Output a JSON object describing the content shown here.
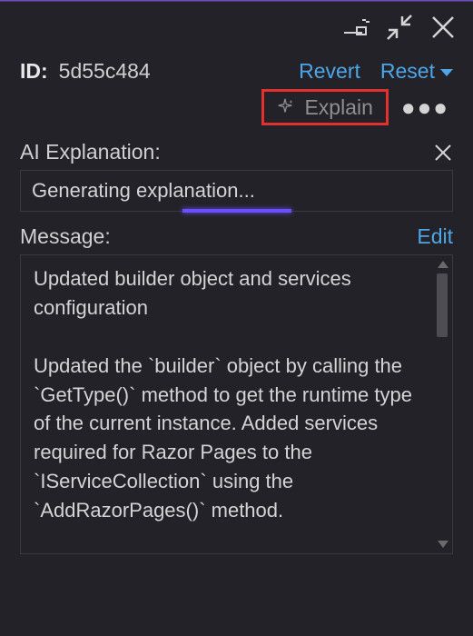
{
  "id": {
    "label": "ID:",
    "value": "5d55c484"
  },
  "actions": {
    "revert": "Revert",
    "reset": "Reset",
    "explain": "Explain",
    "edit": "Edit"
  },
  "ai_explanation": {
    "title": "AI Explanation:",
    "status": "Generating explanation..."
  },
  "message": {
    "title": "Message:",
    "body": "Updated builder object and services configuration\n\nUpdated the `builder` object by calling the `GetType()` method to get the runtime type of the current instance. Added services required for Razor Pages to the `IServiceCollection` using the `AddRazorPages()` method."
  },
  "colors": {
    "link": "#4ea6e6",
    "highlight_border": "#e3312e",
    "accent": "#6b4fff",
    "bg": "#232228"
  }
}
